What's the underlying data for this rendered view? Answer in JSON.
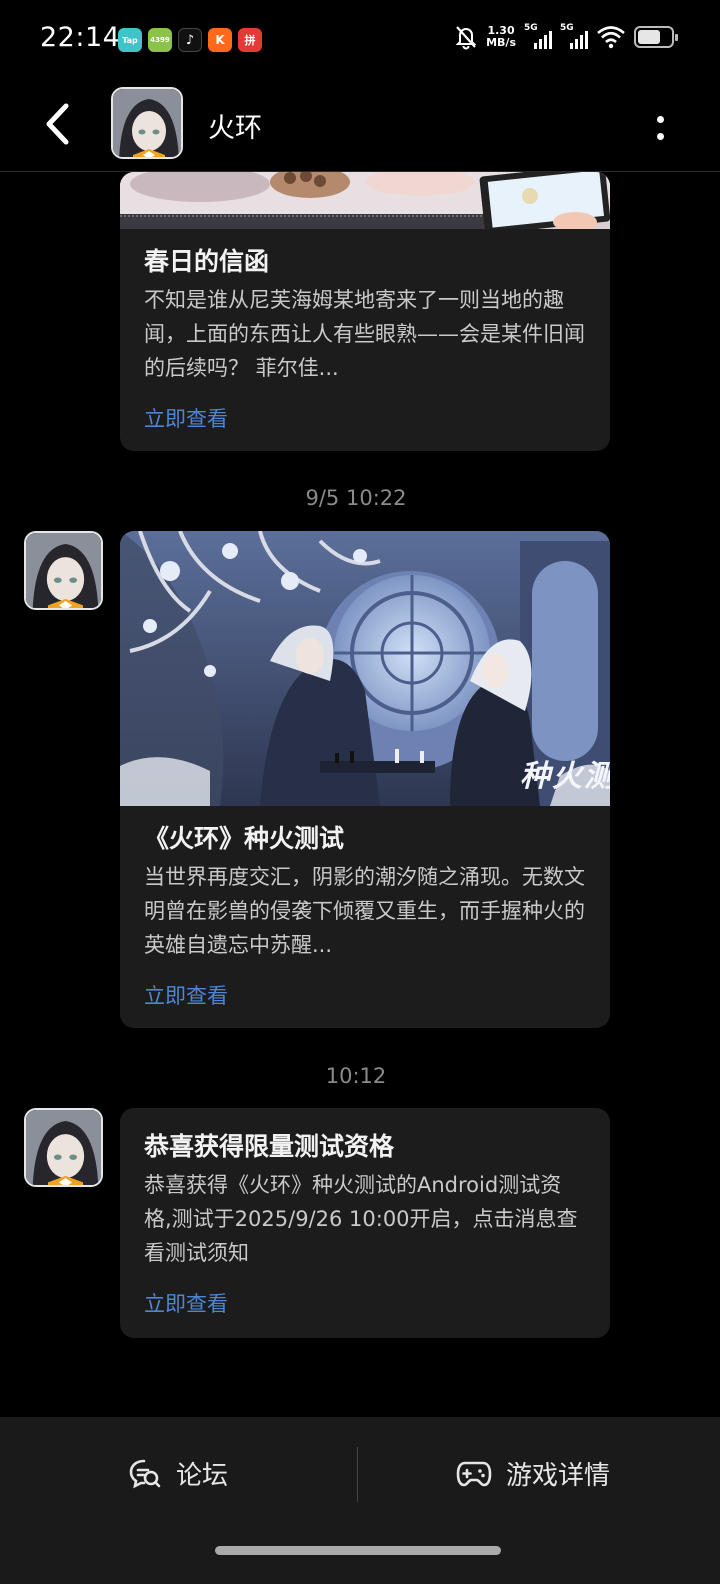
{
  "status_bar": {
    "time": "22:14",
    "apps": [
      {
        "name": "taptap-icon",
        "label": "Tap",
        "color": "#3ec4c9"
      },
      {
        "name": "game-app-icon",
        "label": "4399",
        "color": "#8bc34a"
      },
      {
        "name": "tiktok-icon",
        "label": "♪",
        "color": "#111111"
      },
      {
        "name": "kuaishou-icon",
        "label": "K",
        "color": "#ff6a1a"
      },
      {
        "name": "pinduoduo-icon",
        "label": "拼",
        "color": "#e53935"
      }
    ],
    "net_speed_value": "1.30",
    "net_speed_unit": "MB/s",
    "signal1": "5G",
    "signal2": "5G"
  },
  "header": {
    "title": "火环"
  },
  "messages": [
    {
      "title": "春日的信函",
      "text": "不知是谁从尼芙海姆某地寄来了一则当地的趣闻，上面的东西让人有些眼熟——会是某件旧闻的后续吗？ 菲尔佳...",
      "link": "立即查看"
    },
    {
      "timestamp": "9/5  10:22",
      "title": "《火环》种火测试",
      "text": "当世界再度交汇，阴影的潮汐随之涌现。无数文明曾在影兽的侵袭下倾覆又重生，而手握种火的英雄自遗忘中苏醒...",
      "link": "立即查看",
      "banner_caption": "种火测"
    },
    {
      "timestamp": "10:12",
      "title": "恭喜获得限量测试资格",
      "text": "恭喜获得《火环》种火测试的Android测试资格,测试于2025/9/26 10:00开启，点击消息查看测试须知",
      "link": "立即查看"
    }
  ],
  "bottom_bar": {
    "forum_label": "论坛",
    "details_label": "游戏详情"
  },
  "colors": {
    "background": "#000000",
    "card": "#1c1c1d",
    "link": "#4c86d6",
    "bottom_bar": "#1a1a1b"
  }
}
